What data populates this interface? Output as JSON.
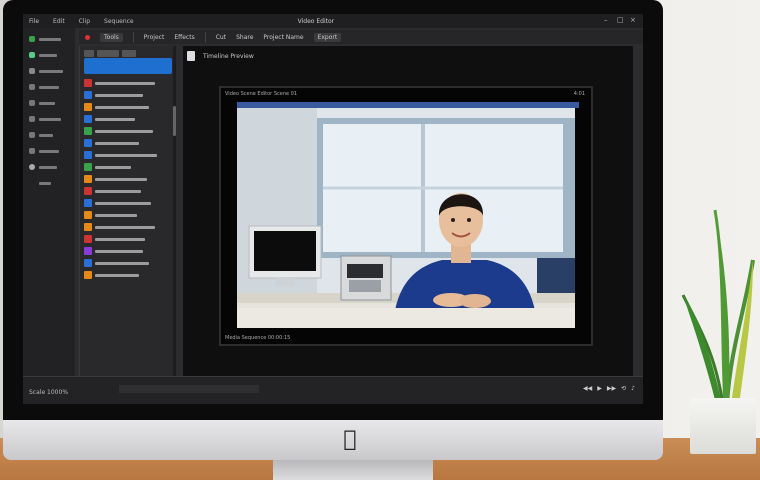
{
  "menubar": {
    "items": [
      "File",
      "Edit",
      "Clip",
      "Sequence"
    ],
    "title": "Video Editor"
  },
  "toolbar": {
    "items": [
      "Tools",
      "Project",
      "Effects",
      "Cut",
      "Share",
      "Project Name",
      "Export"
    ]
  },
  "viewport": {
    "header": "Timeline Preview",
    "frame_label": "Video Scene Editor Scene 01",
    "frame_time": "4:01",
    "bottom_label": "Media Sequence 00:00:15"
  },
  "timeline": {
    "left_label": "Scale 1000%",
    "tool_icons": [
      "rewind-icon",
      "play-icon",
      "forward-icon",
      "loop-icon",
      "audio-icon"
    ]
  },
  "colors": {
    "accent": "#1f6fd1",
    "record": "#d33333",
    "shirt": "#1c3b8c"
  }
}
